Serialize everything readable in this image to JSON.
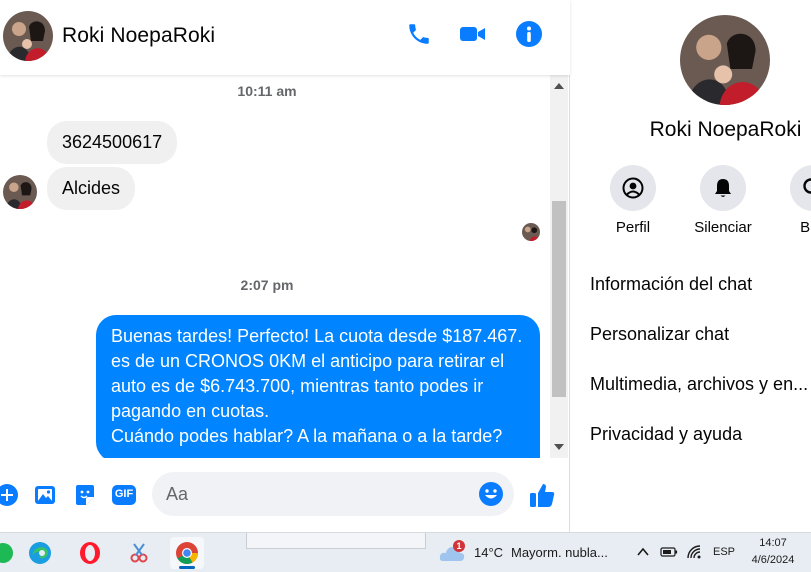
{
  "chat": {
    "name": "Roki NoepaRoki"
  },
  "messages": {
    "timestamp1": "10:11 am",
    "incoming": [
      "3624500617",
      "Alcides"
    ],
    "timestamp2": "2:07 pm",
    "outgoing_lines": [
      "Buenas tardes! Perfecto! La cuota desde $187.467.",
      "es de un CRONOS 0KM el anticipo para retirar el",
      "auto es de $6.743.700, mientras tanto podes ir",
      "pagando en cuotas.",
      "Cuándo podes hablar? A la mañana o a la tarde?"
    ]
  },
  "composer": {
    "placeholder": "Aa",
    "gif_label": "GIF"
  },
  "profile": {
    "name": "Roki NoepaRoki",
    "actions": [
      {
        "label": "Perfil",
        "icon": "profile-icon"
      },
      {
        "label": "Silenciar",
        "icon": "bell-icon"
      },
      {
        "label": "Bus",
        "icon": "search-icon"
      }
    ],
    "menu": [
      "Información del chat",
      "Personalizar chat",
      "Multimedia, archivos y en...",
      "Privacidad y ayuda"
    ]
  },
  "taskbar": {
    "apps": [
      "spotify-icon",
      "edge-icon",
      "opera-icon",
      "snipping-tool-icon",
      "chrome-icon"
    ],
    "weather_badge": "1",
    "weather": "14°C",
    "weather_desc": "Mayorm. nubla...",
    "language": "ESP",
    "time": "14:07",
    "date": "4/6/2024"
  },
  "colors": {
    "messenger_blue": "#0084ff",
    "icon_blue": "#0a7cff",
    "bubble_gray": "#f0f0f0"
  }
}
